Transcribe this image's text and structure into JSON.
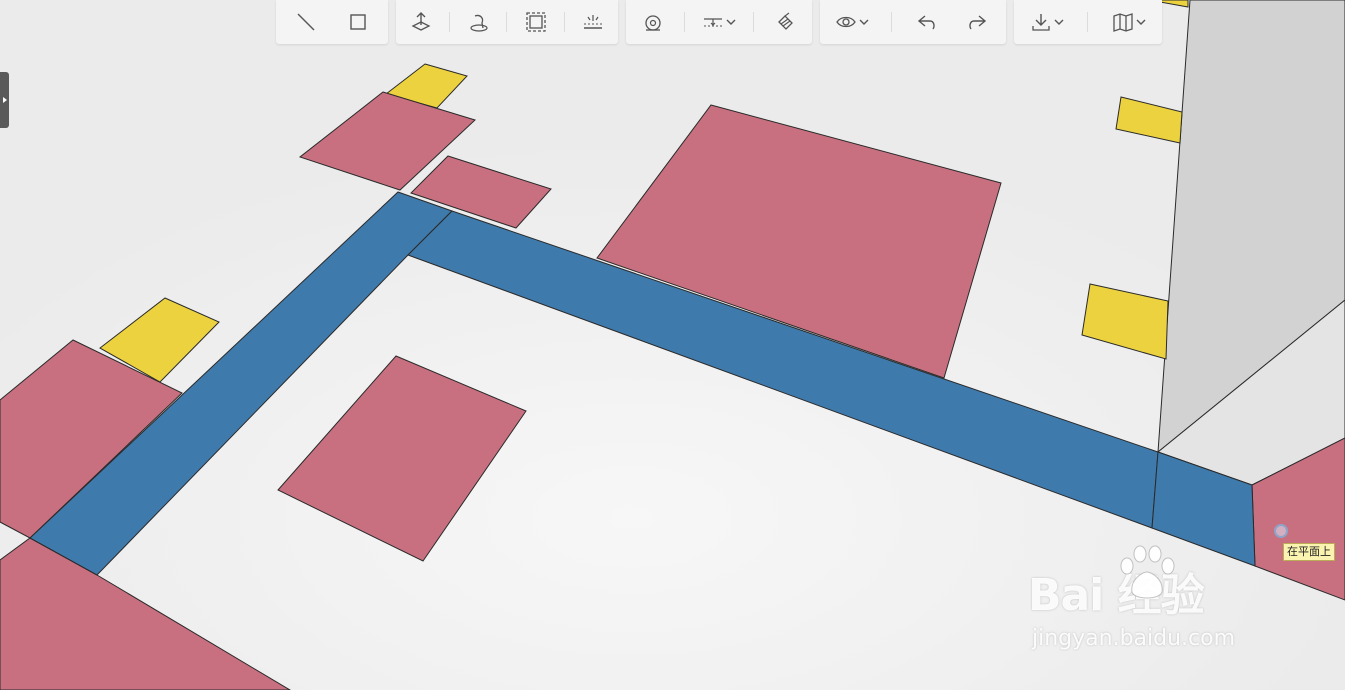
{
  "canvas": {
    "background": "#ededed",
    "wall_color": "#d3d3d3",
    "colors": {
      "room": "#c87080",
      "corridor": "#3f7aac",
      "door": "#ecd23e",
      "outline": "#2a2a2a"
    }
  },
  "toolbar": {
    "groups": [
      [
        {
          "name": "line-tool-button",
          "icon": "line-icon"
        },
        {
          "name": "rectangle-tool-button",
          "icon": "square-icon"
        }
      ],
      [
        {
          "name": "push-pull-button",
          "icon": "push-pull-icon"
        },
        {
          "name": "follow-me-button",
          "icon": "follow-me-icon"
        },
        {
          "name": "offset-button",
          "icon": "offset-icon"
        },
        {
          "name": "section-plane-button",
          "icon": "section-plane-icon"
        }
      ],
      [
        {
          "name": "tape-measure-button",
          "icon": "tape-measure-icon"
        },
        {
          "name": "dimension-dropdown-button",
          "icon": "dimension-icon",
          "dropdown": true
        },
        {
          "name": "paint-bucket-button",
          "icon": "paint-bucket-icon"
        }
      ],
      [
        {
          "name": "view-dropdown-button",
          "icon": "eye-icon",
          "dropdown": true
        },
        {
          "name": "undo-button",
          "icon": "undo-icon"
        },
        {
          "name": "redo-button",
          "icon": "redo-icon"
        }
      ],
      [
        {
          "name": "export-dropdown-button",
          "icon": "download-icon",
          "dropdown": true
        },
        {
          "name": "map-dropdown-button",
          "icon": "map-icon",
          "dropdown": true
        }
      ]
    ]
  },
  "cursor": {
    "tooltip": "在平面上"
  },
  "watermark": {
    "brand": "Bai  经验",
    "url": "jingyan.baidu.com"
  }
}
